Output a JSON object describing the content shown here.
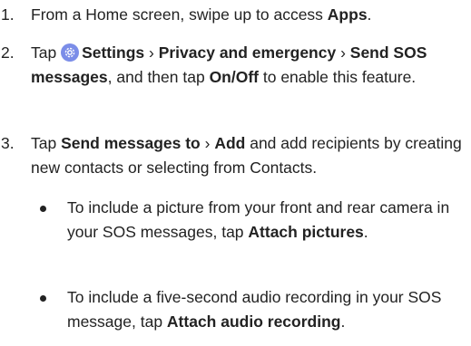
{
  "steps": [
    {
      "num": "1.",
      "text_1": "From a Home screen, swipe up to access ",
      "bold_1": "Apps",
      "text_2": "."
    },
    {
      "num": "2.",
      "text_1": "Tap ",
      "icon": "settings-gear-icon",
      "bold_1": "Settings",
      "sep_1": " › ",
      "bold_2": "Privacy and emergency",
      "sep_2": " › ",
      "bold_3": "Send SOS messages",
      "text_2": ", and then tap ",
      "bold_4": "On/Off",
      "text_3": " to enable this feature."
    },
    {
      "num": "3.",
      "text_1": "Tap ",
      "bold_1": "Send messages to",
      "sep_1": " › ",
      "bold_2": "Add",
      "text_2": " and add recipients by creating new contacts or selecting from Contacts."
    }
  ],
  "bullets": [
    {
      "text_1": "To include a picture from your front and rear camera in your SOS messages, tap ",
      "bold_1": "Attach pictures",
      "text_2": "."
    },
    {
      "text_1": "To include a five-second audio recording in your SOS message, tap ",
      "bold_1": "Attach audio recording",
      "text_2": "."
    }
  ],
  "colors": {
    "text": "#222222",
    "icon_bg": "#7b8de8"
  }
}
